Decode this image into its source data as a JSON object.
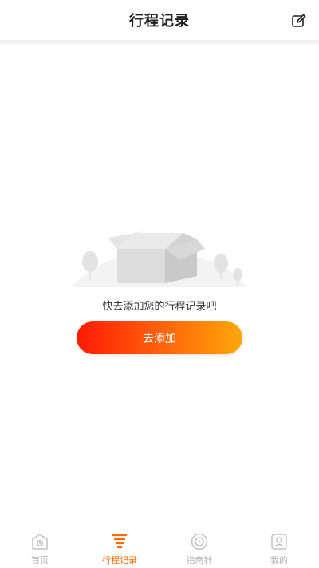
{
  "header": {
    "title": "行程记录",
    "edit_icon": "edit-icon"
  },
  "empty_state": {
    "message": "快去添加您的行程记录吧",
    "illustration_icon": "empty-box-illustration"
  },
  "add_button": {
    "label": "去添加"
  },
  "tabbar": {
    "active_color": "#ff6a00",
    "inactive_color": "#b4b4b4",
    "items": [
      {
        "label": "首页",
        "icon": "home-icon",
        "active": false
      },
      {
        "label": "行程记录",
        "icon": "trip-record-icon",
        "active": true
      },
      {
        "label": "指南针",
        "icon": "compass-icon",
        "active": false
      },
      {
        "label": "我的",
        "icon": "profile-icon",
        "active": false
      }
    ]
  }
}
